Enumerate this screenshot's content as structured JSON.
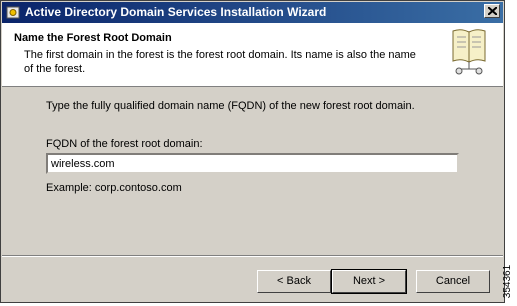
{
  "window": {
    "title": "Active Directory Domain Services Installation Wizard"
  },
  "header": {
    "title": "Name the Forest Root Domain",
    "description": "The first domain in the forest is the forest root domain. Its name is also the name of the forest."
  },
  "main": {
    "instruction": "Type the fully qualified domain name (FQDN) of the new forest root domain.",
    "fqdn_label": "FQDN of the forest root domain:",
    "fqdn_value": "wireless.com",
    "example": "Example: corp.contoso.com"
  },
  "buttons": {
    "back": "< Back",
    "next": "Next >",
    "cancel": "Cancel"
  },
  "figure_id": "354361",
  "icons": {
    "app": "wizard-icon",
    "header": "book-icon",
    "close": "close-icon"
  },
  "colors": {
    "titlebar_start": "#0a246a",
    "titlebar_end": "#3a6ea5",
    "dialog_bg": "#d4d0c8"
  }
}
